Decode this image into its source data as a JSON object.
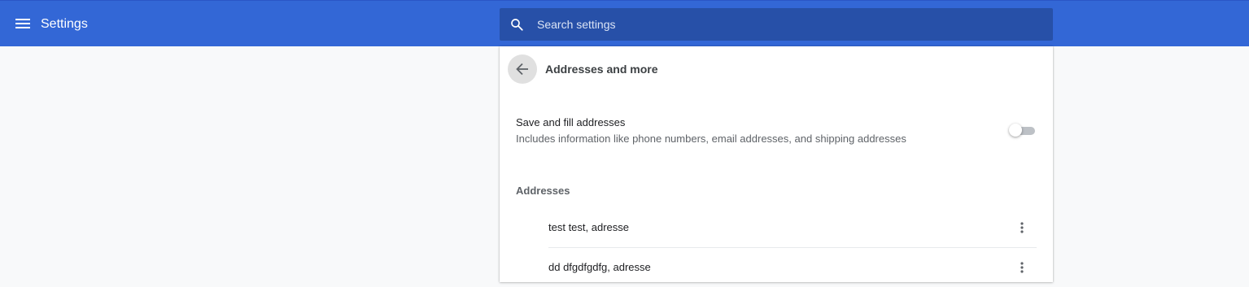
{
  "header": {
    "menu_icon": "hamburger-menu-icon",
    "title": "Settings",
    "search": {
      "icon": "search-icon",
      "placeholder": "Search settings",
      "value": ""
    }
  },
  "page": {
    "back_icon": "arrow-back-icon",
    "title": "Addresses and more"
  },
  "save_fill": {
    "title": "Save and fill addresses",
    "description": "Includes information like phone numbers, email addresses, and shipping addresses",
    "enabled": false
  },
  "addresses": {
    "heading": "Addresses",
    "items": [
      {
        "label": "test test, adresse",
        "menu_icon": "more-vert-icon"
      },
      {
        "label": "dd dfgdfgdfg, adresse",
        "menu_icon": "more-vert-icon"
      }
    ]
  },
  "colors": {
    "header_bg": "#3367d6",
    "search_bg": "#2750a8",
    "page_bg": "#f8f9fa"
  }
}
